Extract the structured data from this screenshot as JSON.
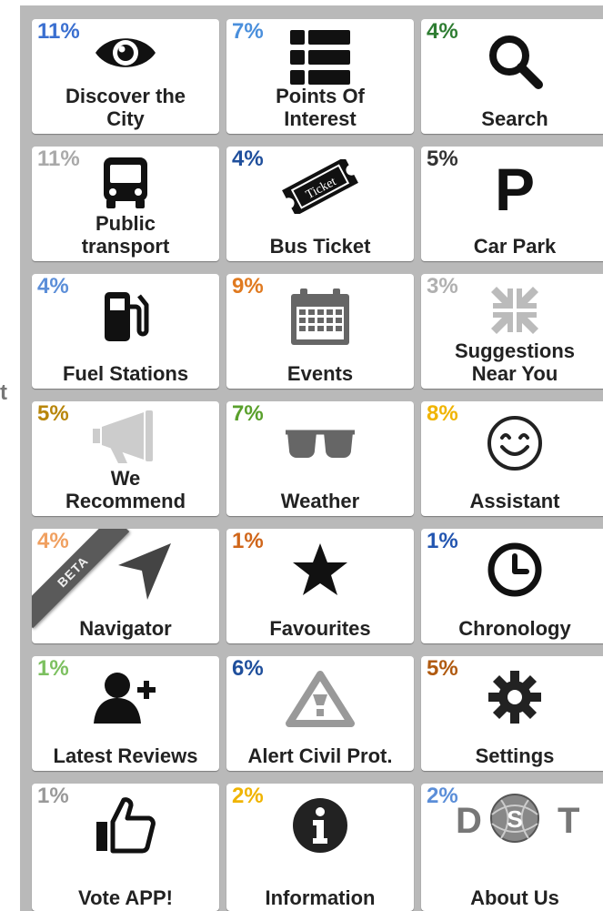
{
  "edge_fragment": "t",
  "tiles": [
    {
      "pct": "11%",
      "pct_color": "#3a6fd0",
      "label": "Discover the\nCity",
      "icon": "eye-icon"
    },
    {
      "pct": "7%",
      "pct_color": "#4a8fdc",
      "label": "Points Of\nInterest",
      "icon": "list-icon"
    },
    {
      "pct": "4%",
      "pct_color": "#2e7d32",
      "label": "Search",
      "icon": "search-icon"
    },
    {
      "pct": "11%",
      "pct_color": "#a9a9a9",
      "label": "Public\ntransport",
      "icon": "bus-icon"
    },
    {
      "pct": "4%",
      "pct_color": "#1f4f9c",
      "label": "Bus Ticket",
      "icon": "ticket-icon",
      "ticket_text": "Ticket"
    },
    {
      "pct": "5%",
      "pct_color": "#333333",
      "label": "Car Park",
      "icon": "parking-icon",
      "icon_text": "P"
    },
    {
      "pct": "4%",
      "pct_color": "#5b8ed8",
      "label": "Fuel Stations",
      "icon": "fuel-pump-icon"
    },
    {
      "pct": "9%",
      "pct_color": "#e07a20",
      "label": "Events",
      "icon": "calendar-icon"
    },
    {
      "pct": "3%",
      "pct_color": "#b0b0b0",
      "label": "Suggestions\nNear You",
      "icon": "compress-arrows-icon"
    },
    {
      "pct": "5%",
      "pct_color": "#b8860b",
      "label": "We\nRecommend",
      "icon": "megaphone-icon"
    },
    {
      "pct": "7%",
      "pct_color": "#5aa02c",
      "label": "Weather",
      "icon": "sunglasses-icon"
    },
    {
      "pct": "8%",
      "pct_color": "#f0b400",
      "label": "Assistant",
      "icon": "smiley-icon"
    },
    {
      "pct": "4%",
      "pct_color": "#f0a060",
      "label": "Navigator",
      "icon": "navigation-arrow-icon",
      "badge": "BETA"
    },
    {
      "pct": "1%",
      "pct_color": "#d0661a",
      "label": "Favourites",
      "icon": "star-icon"
    },
    {
      "pct": "1%",
      "pct_color": "#2255b0",
      "label": "Chronology",
      "icon": "clock-icon"
    },
    {
      "pct": "1%",
      "pct_color": "#7cc060",
      "label": "Latest Reviews",
      "icon": "add-user-icon"
    },
    {
      "pct": "6%",
      "pct_color": "#1f4f9c",
      "label": "Alert Civil Prot.",
      "icon": "warning-triangle-icon"
    },
    {
      "pct": "5%",
      "pct_color": "#b05a10",
      "label": "Settings",
      "icon": "gear-icon"
    },
    {
      "pct": "1%",
      "pct_color": "#999999",
      "label": "Vote APP!",
      "icon": "thumbs-up-icon"
    },
    {
      "pct": "2%",
      "pct_color": "#f0b400",
      "label": "Information",
      "icon": "info-icon"
    },
    {
      "pct": "2%",
      "pct_color": "#5b8ed8",
      "label": "About Us",
      "icon": "dsit-logo-icon",
      "logo_text": "DSIT"
    }
  ]
}
